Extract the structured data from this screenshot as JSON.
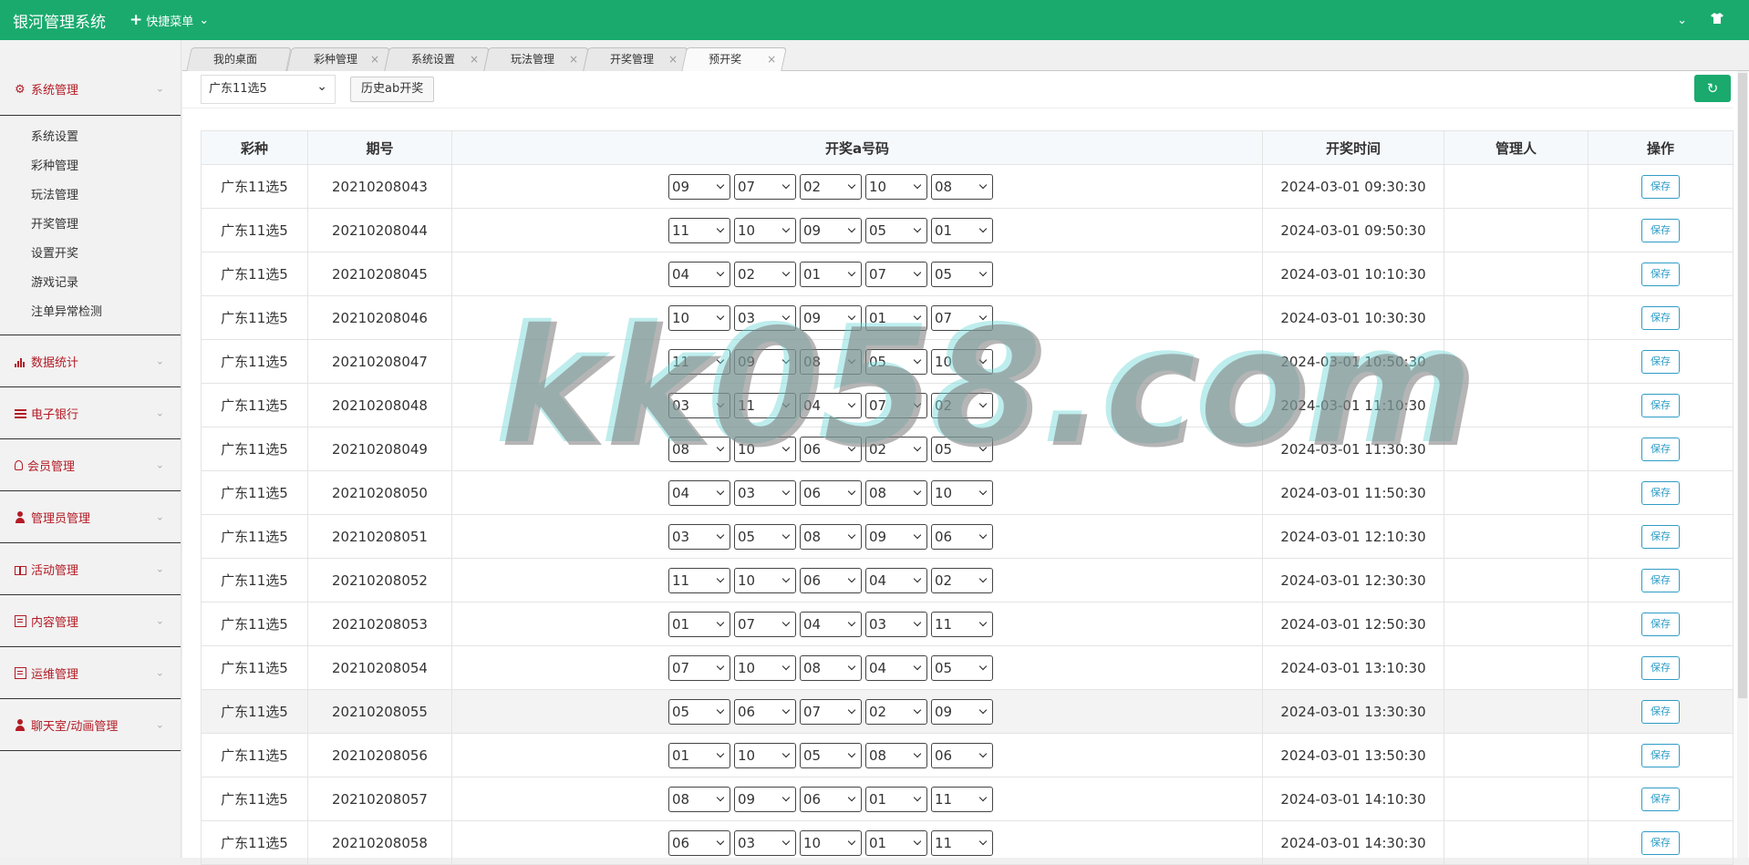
{
  "app": {
    "title": "银河管理系统",
    "quick_menu": "快捷菜单"
  },
  "sidebar": {
    "groups": [
      {
        "label": "系统管理",
        "icon": "gear-icon",
        "expanded": true,
        "items": [
          "系统设置",
          "彩种管理",
          "玩法管理",
          "开奖管理",
          "设置开奖",
          "游戏记录",
          "注单异常检测"
        ]
      },
      {
        "label": "数据统计",
        "icon": "chart-icon"
      },
      {
        "label": "电子银行",
        "icon": "list-icon"
      },
      {
        "label": "会员管理",
        "icon": "user-icon"
      },
      {
        "label": "管理员管理",
        "icon": "admin-icon"
      },
      {
        "label": "活动管理",
        "icon": "gift-icon"
      },
      {
        "label": "内容管理",
        "icon": "book-icon"
      },
      {
        "label": "运维管理",
        "icon": "book-icon"
      },
      {
        "label": "聊天室/动画管理",
        "icon": "admin-icon"
      }
    ]
  },
  "tabs": [
    {
      "label": "我的桌面",
      "closable": false
    },
    {
      "label": "彩种管理",
      "closable": true
    },
    {
      "label": "系统设置",
      "closable": true
    },
    {
      "label": "玩法管理",
      "closable": true
    },
    {
      "label": "开奖管理",
      "closable": true
    },
    {
      "label": "预开奖",
      "closable": true,
      "active": true
    }
  ],
  "toolbar": {
    "lottery": "广东11选5",
    "history_button": "历史ab开奖"
  },
  "table": {
    "columns": [
      "彩种",
      "期号",
      "开奖a号码",
      "开奖时间",
      "管理人",
      "操作"
    ],
    "save_label": "保存",
    "rows": [
      {
        "lottery": "广东11选5",
        "issue": "20210208043",
        "numbers": [
          "09",
          "07",
          "02",
          "10",
          "08"
        ],
        "time": "2024-03-01 09:30:30",
        "manager": ""
      },
      {
        "lottery": "广东11选5",
        "issue": "20210208044",
        "numbers": [
          "11",
          "10",
          "09",
          "05",
          "01"
        ],
        "time": "2024-03-01 09:50:30",
        "manager": ""
      },
      {
        "lottery": "广东11选5",
        "issue": "20210208045",
        "numbers": [
          "04",
          "02",
          "01",
          "07",
          "05"
        ],
        "time": "2024-03-01 10:10:30",
        "manager": ""
      },
      {
        "lottery": "广东11选5",
        "issue": "20210208046",
        "numbers": [
          "10",
          "03",
          "09",
          "01",
          "07"
        ],
        "time": "2024-03-01 10:30:30",
        "manager": ""
      },
      {
        "lottery": "广东11选5",
        "issue": "20210208047",
        "numbers": [
          "11",
          "09",
          "08",
          "05",
          "10"
        ],
        "time": "2024-03-01 10:50:30",
        "manager": ""
      },
      {
        "lottery": "广东11选5",
        "issue": "20210208048",
        "numbers": [
          "03",
          "11",
          "04",
          "07",
          "02"
        ],
        "time": "2024-03-01 11:10:30",
        "manager": ""
      },
      {
        "lottery": "广东11选5",
        "issue": "20210208049",
        "numbers": [
          "08",
          "10",
          "06",
          "02",
          "05"
        ],
        "time": "2024-03-01 11:30:30",
        "manager": ""
      },
      {
        "lottery": "广东11选5",
        "issue": "20210208050",
        "numbers": [
          "04",
          "03",
          "06",
          "08",
          "10"
        ],
        "time": "2024-03-01 11:50:30",
        "manager": ""
      },
      {
        "lottery": "广东11选5",
        "issue": "20210208051",
        "numbers": [
          "03",
          "05",
          "08",
          "09",
          "06"
        ],
        "time": "2024-03-01 12:10:30",
        "manager": ""
      },
      {
        "lottery": "广东11选5",
        "issue": "20210208052",
        "numbers": [
          "11",
          "10",
          "06",
          "04",
          "02"
        ],
        "time": "2024-03-01 12:30:30",
        "manager": ""
      },
      {
        "lottery": "广东11选5",
        "issue": "20210208053",
        "numbers": [
          "01",
          "07",
          "04",
          "03",
          "11"
        ],
        "time": "2024-03-01 12:50:30",
        "manager": ""
      },
      {
        "lottery": "广东11选5",
        "issue": "20210208054",
        "numbers": [
          "07",
          "10",
          "08",
          "04",
          "05"
        ],
        "time": "2024-03-01 13:10:30",
        "manager": ""
      },
      {
        "lottery": "广东11选5",
        "issue": "20210208055",
        "numbers": [
          "05",
          "06",
          "07",
          "02",
          "09"
        ],
        "time": "2024-03-01 13:30:30",
        "manager": "",
        "highlighted": true
      },
      {
        "lottery": "广东11选5",
        "issue": "20210208056",
        "numbers": [
          "01",
          "10",
          "05",
          "08",
          "06"
        ],
        "time": "2024-03-01 13:50:30",
        "manager": ""
      },
      {
        "lottery": "广东11选5",
        "issue": "20210208057",
        "numbers": [
          "08",
          "09",
          "06",
          "01",
          "11"
        ],
        "time": "2024-03-01 14:10:30",
        "manager": ""
      },
      {
        "lottery": "广东11选5",
        "issue": "20210208058",
        "numbers": [
          "06",
          "03",
          "10",
          "01",
          "11"
        ],
        "time": "2024-03-01 14:30:30",
        "manager": ""
      }
    ]
  },
  "watermark": "kk058.com",
  "colors": {
    "topbar": "#1aaa6e",
    "nav_text": "#b31b25",
    "save_button": "#2f9cc6"
  }
}
